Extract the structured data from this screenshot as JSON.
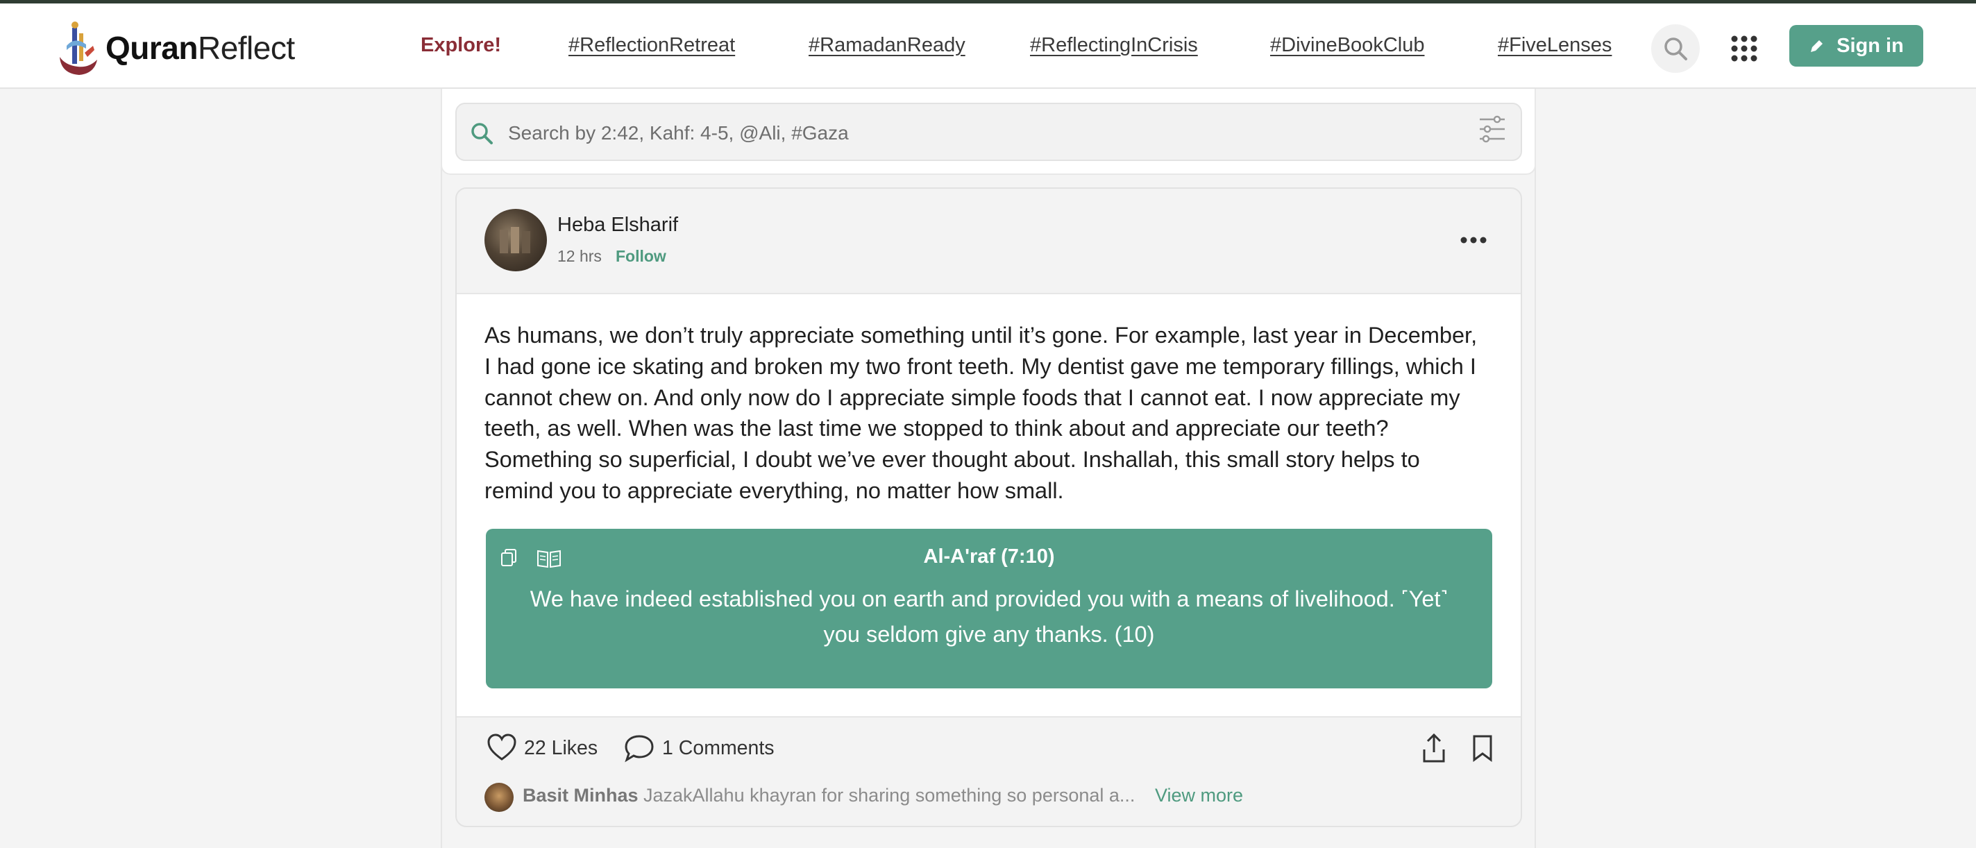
{
  "brand": {
    "bold": "Quran",
    "regular": "Reflect"
  },
  "nav": {
    "explore": "Explore!",
    "links": [
      "#ReflectionRetreat",
      "#RamadanReady",
      "#ReflectingInCrisis",
      "#DivineBookClub",
      "#FiveLenses"
    ],
    "signin_label": "Sign in"
  },
  "search": {
    "placeholder": "Search by 2:42, Kahf: 4-5, @Ali, #Gaza",
    "value": ""
  },
  "post": {
    "author": "Heba Elsharif",
    "time": "12 hrs",
    "follow_label": "Follow",
    "text": "As humans, we don’t truly appreciate something until it’s gone. For example, last year in December, I had gone ice skating and broken my two front teeth. My dentist gave me temporary fillings, which I cannot chew on. And only now do I appreciate simple foods that I cannot eat. I now appreciate my teeth, as well. When was the last time we stopped to think about and appreciate our teeth? Something so superficial, I doubt we’ve ever thought about. Inshallah, this small story helps to remind you to appreciate everything, no matter how small.",
    "verse": {
      "reference": "Al-A'raf (7:10)",
      "text": "We have indeed established you on earth and provided you with a means of livelihood. ˹Yet˺ you seldom give any thanks. (10)"
    },
    "likes_label": "22 Likes",
    "comments_label": "1 Comments",
    "latest_comment": {
      "author": "Basit Minhas",
      "text": "JazakAllahu khayran for sharing something so personal a...",
      "view_more": "View more"
    }
  },
  "colors": {
    "accent": "#56a08a",
    "explore": "#8a2d36",
    "topline": "#2f3d33"
  }
}
